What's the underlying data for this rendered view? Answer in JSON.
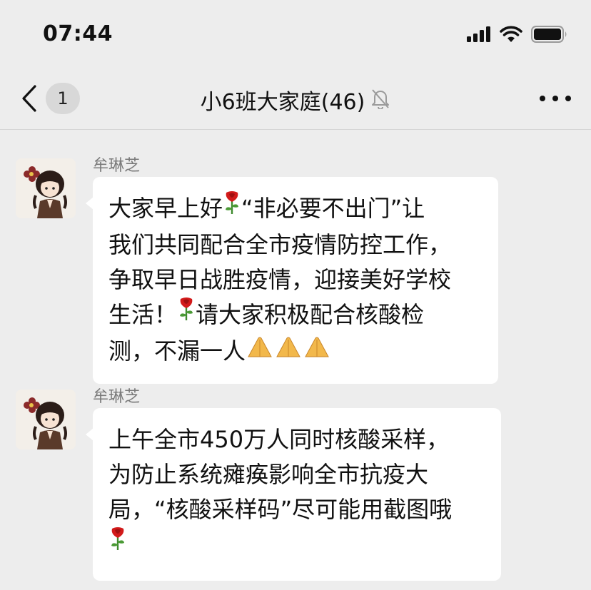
{
  "status_bar": {
    "time": "07:44",
    "icons": [
      "signal-icon",
      "wifi-icon",
      "battery-icon"
    ]
  },
  "nav": {
    "back_icon": "chevron-left-icon",
    "unread_count": "1",
    "title": "小6班大家庭(46)",
    "mute_icon": "bell-muted-icon",
    "more_icon": "more-dots-icon"
  },
  "messages": [
    {
      "sender": "牟琳芝",
      "avatar": "cartoon-girl-avatar",
      "segments": [
        [
          "大家早上好",
          "🌹",
          "“非必要不出门”让"
        ],
        [
          "我们共同配合全市疫情防控工作，"
        ],
        [
          "争取早日战胜疫情，迎接美好学校"
        ],
        [
          "生活！",
          "🌹",
          "请大家积极配合核酸检"
        ],
        [
          "测，不漏一人",
          "🙏🙏🙏"
        ]
      ]
    },
    {
      "sender": "牟琳芝",
      "avatar": "cartoon-girl-avatar",
      "segments": [
        [
          "上午全市450万人同时核酸采样，"
        ],
        [
          "为防止系统瘫痪影响全市抗疫大"
        ],
        [
          "局，“核酸采样码”尽可能用截图哦"
        ],
        [
          "🌹"
        ]
      ]
    }
  ],
  "colors": {
    "background": "#ededed",
    "bubble": "#ffffff",
    "sender_text": "#7a7a7a",
    "rose": "#d21a1a",
    "hands": "#f2b84b"
  }
}
